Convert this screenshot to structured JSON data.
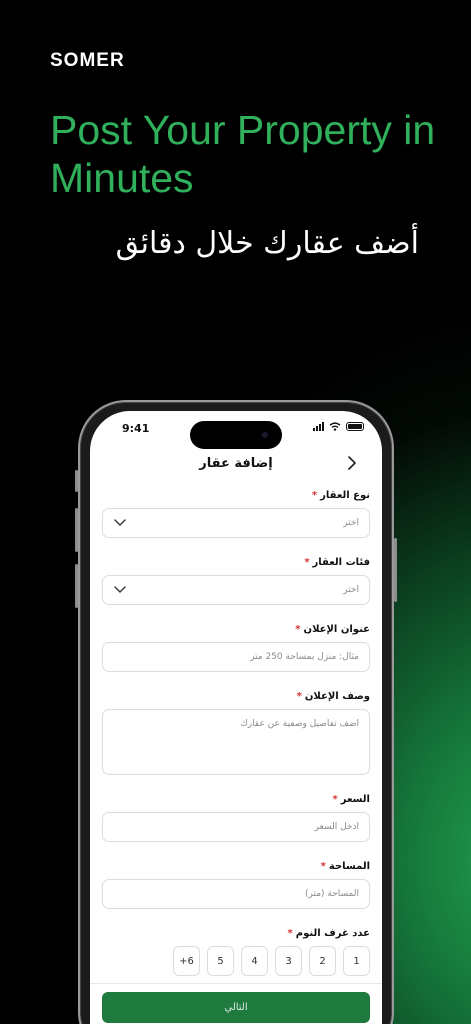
{
  "brand": "SOMER",
  "headline_en": "Post Your Property in Minutes",
  "headline_ar": "أضف عقارك خلال دقائق",
  "colors": {
    "accent": "#31b05c",
    "button": "#1f7a3d",
    "required": "#d23030"
  },
  "status_bar": {
    "time": "9:41",
    "icons": [
      "signal-icon",
      "wifi-icon",
      "battery-icon"
    ]
  },
  "nav": {
    "title": "إضافة عقار",
    "back_icon": "chevron-right-icon"
  },
  "form": {
    "property_type": {
      "label": "نوع العقار",
      "required_mark": "*",
      "placeholder": "اختر"
    },
    "property_category": {
      "label": "فئات العقار",
      "required_mark": "*",
      "placeholder": "اختر"
    },
    "ad_title": {
      "label": "عنوان الإعلان",
      "required_mark": "*",
      "placeholder": "مثال: منزل بمساحة 250 متر"
    },
    "ad_description": {
      "label": "وصف الإعلان",
      "required_mark": "*",
      "placeholder": "اضف تفاصيل وصفية عن عقارك"
    },
    "price": {
      "label": "السعر",
      "required_mark": "*",
      "placeholder": "ادخل السعر"
    },
    "area": {
      "label": "المساحة",
      "required_mark": "*",
      "placeholder": "المساحة (متر)"
    },
    "bedrooms": {
      "label": "عدد غرف النوم",
      "required_mark": "*",
      "options": [
        "1",
        "2",
        "3",
        "4",
        "5",
        "+6"
      ]
    }
  },
  "next_button": "التالي"
}
